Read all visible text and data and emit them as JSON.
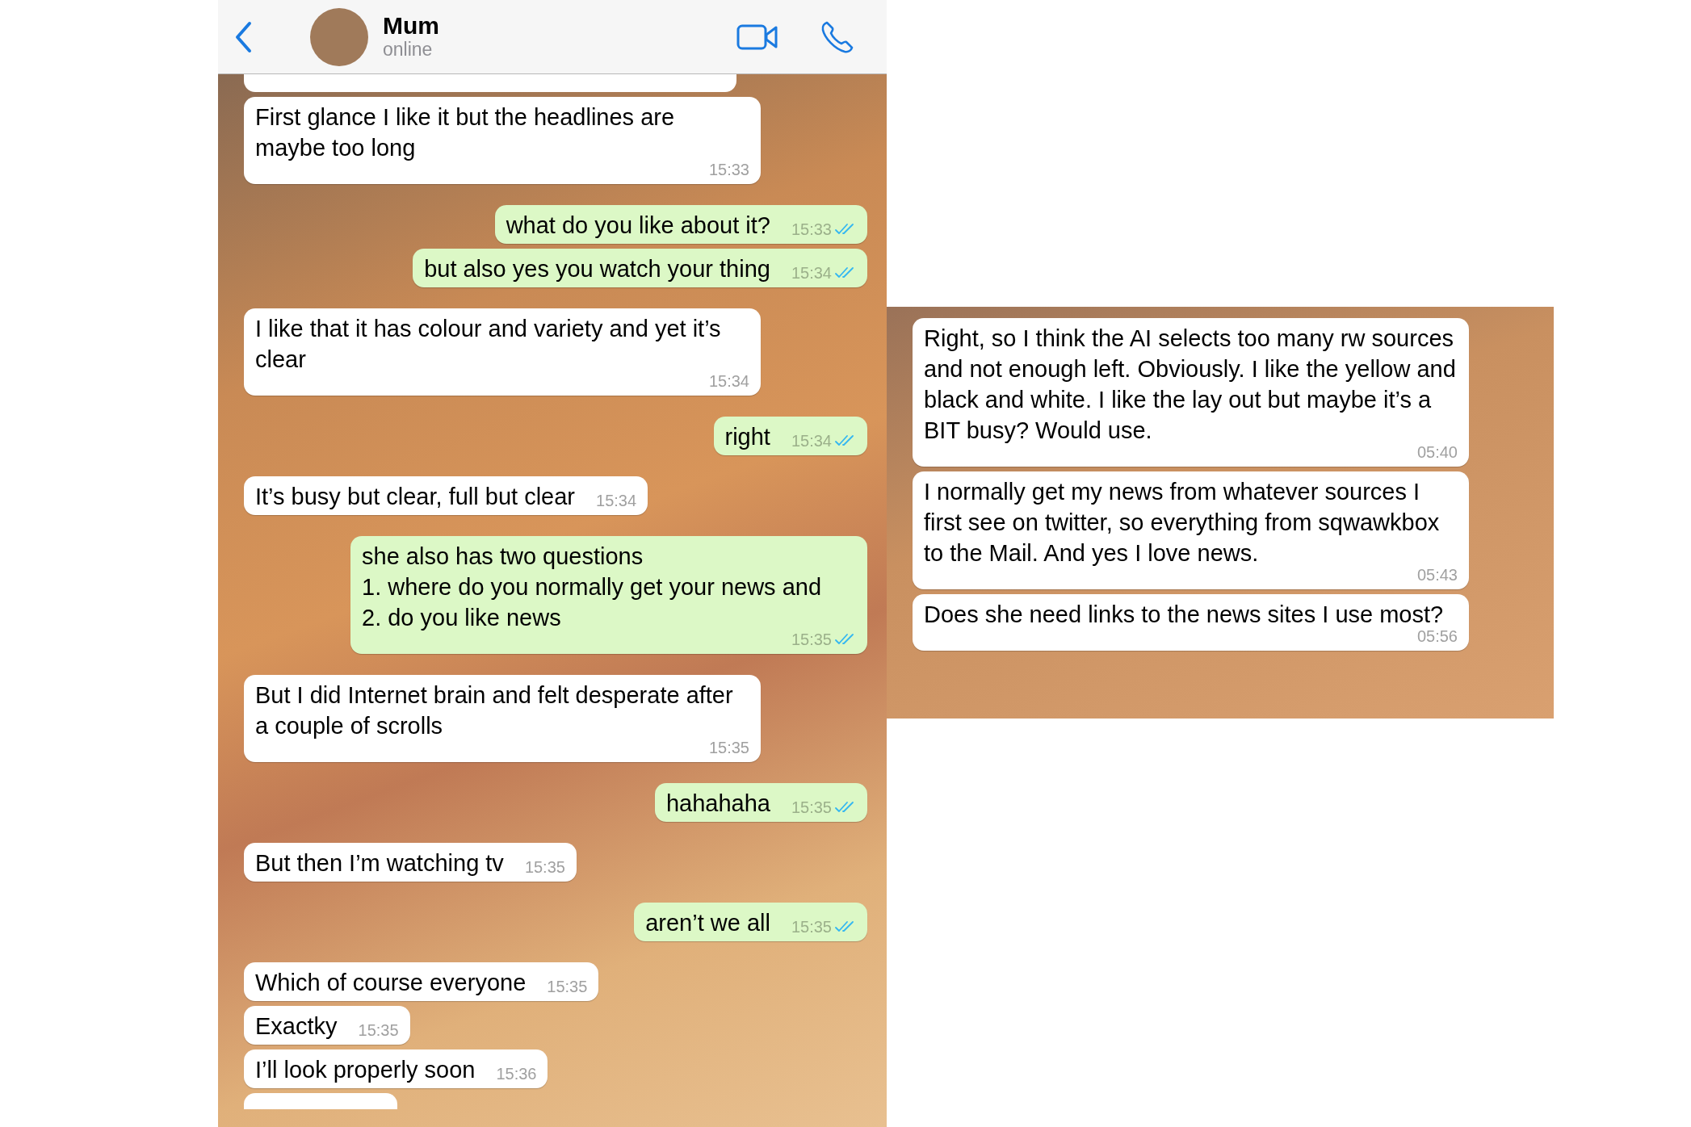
{
  "left_chat": {
    "header": {
      "contact_name": "Mum",
      "status": "online"
    },
    "messages": [
      {
        "kind": "in",
        "text": "First glance I like it but the headlines are maybe too long",
        "time": "15:33"
      },
      {
        "kind": "out",
        "text": "what do you like about it?",
        "time": "15:33",
        "read": true
      },
      {
        "kind": "out",
        "text": "but also yes you watch your thing",
        "time": "15:34",
        "read": true
      },
      {
        "kind": "in",
        "text": "I like that it has colour and variety and yet it’s clear",
        "time": "15:34"
      },
      {
        "kind": "out",
        "text": "right",
        "time": "15:34",
        "read": true
      },
      {
        "kind": "in",
        "text": "It’s busy but clear, full but clear",
        "time": "15:34"
      },
      {
        "kind": "out",
        "text": "she also has two questions\n1. where do you normally get your news and\n2. do you like news",
        "time": "15:35",
        "read": true
      },
      {
        "kind": "in",
        "text": "But I did Internet brain and felt desperate after a couple of scrolls",
        "time": "15:35"
      },
      {
        "kind": "out",
        "text": "hahahaha",
        "time": "15:35",
        "read": true
      },
      {
        "kind": "in",
        "text": "But then I’m watching tv",
        "time": "15:35"
      },
      {
        "kind": "out",
        "text": "aren’t we all",
        "time": "15:35",
        "read": true
      },
      {
        "kind": "in",
        "text": "Which of course everyone",
        "time": "15:35"
      },
      {
        "kind": "in",
        "text": "Exactky",
        "time": "15:35"
      },
      {
        "kind": "in",
        "text": "I’ll look properly soon",
        "time": "15:36"
      }
    ]
  },
  "right_chat": {
    "messages": [
      {
        "kind": "in",
        "text": "Right, so I think the AI selects too many rw sources and not enough left. Obviously. I like the yellow and black and white. I like the lay out but maybe it’s a BIT busy? Would use.",
        "time": "05:40"
      },
      {
        "kind": "in",
        "text": "I normally get my news from whatever sources I first see on twitter, so everything from sqwawkbox to the Mail. And yes I love news.",
        "time": "05:43"
      },
      {
        "kind": "in",
        "text": "Does she need links to the news sites I use most?",
        "time": "05:56"
      }
    ]
  }
}
